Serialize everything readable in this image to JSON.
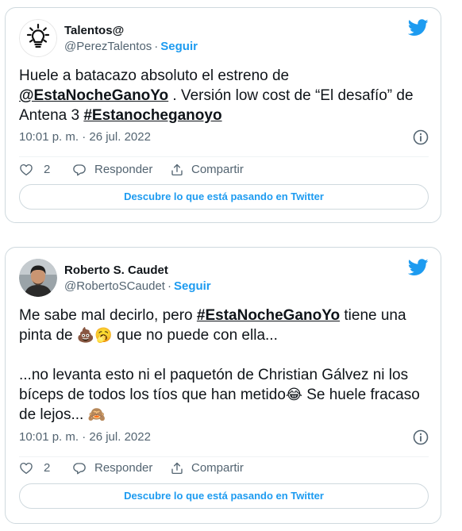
{
  "tweets": [
    {
      "author": {
        "display_name": "Talentos@",
        "handle": "@PerezTalentos",
        "follow_label": "Seguir",
        "avatar_icon": "lightbulb-icon"
      },
      "body": {
        "p1_pre": "Huele a batacazo absoluto el estreno de ",
        "mention": "@EstaNocheGanoYo",
        "p1_post": " . Versión low cost de “El desafío” de Antena 3 ",
        "hashtag": "#Estanocheganoyo"
      },
      "timestamp": "10:01 p. m. · 26 jul. 2022",
      "actions": {
        "likes": "2",
        "reply": "Responder",
        "share": "Compartir"
      },
      "cta": "Descubre lo que está pasando en Twitter"
    },
    {
      "author": {
        "display_name": "Roberto S. Caudet",
        "handle": "@RobertoSCaudet",
        "follow_label": "Seguir",
        "avatar_icon": "profile-photo"
      },
      "body": {
        "p1_pre": "Me sabe mal decirlo, pero ",
        "hashtag": "#EstaNocheGanoYo",
        "p1_mid": " tiene una pinta de ",
        "emoji1": "💩🥱",
        "p1_post": " que no puede con ella...",
        "p2_pre": "...no levanta esto ni el paquetón de Christian Gálvez ni los bíceps de todos los tíos que han metido",
        "emoji2": "😂",
        "p2_mid": " Se huele fracaso de lejos... ",
        "emoji3": "🙈"
      },
      "timestamp": "10:01 p. m. · 26 jul. 2022",
      "actions": {
        "likes": "2",
        "reply": "Responder",
        "share": "Compartir"
      },
      "cta": "Descubre lo que está pasando en Twitter"
    }
  ],
  "colors": {
    "brand": "#1d9bf0",
    "text": "#0f1419",
    "muted": "#536471",
    "border": "#cfd9de"
  },
  "icons": [
    "twitter-bird-icon",
    "info-icon",
    "heart-icon",
    "reply-icon",
    "share-icon"
  ]
}
